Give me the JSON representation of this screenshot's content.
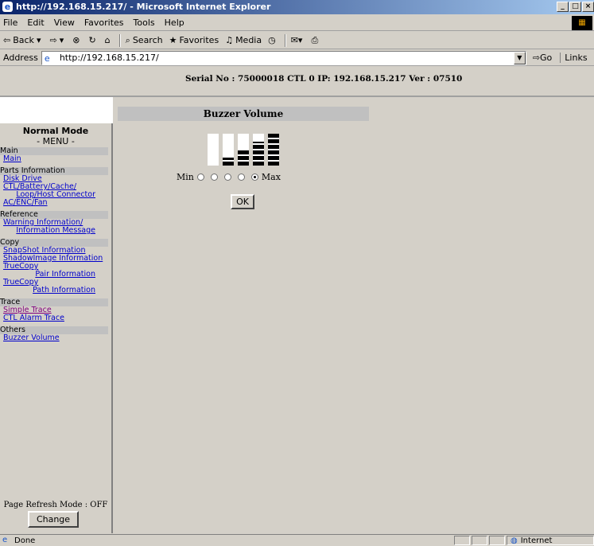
{
  "window": {
    "title": "http://192.168.15.217/ - Microsoft Internet Explorer"
  },
  "menubar": [
    "File",
    "Edit",
    "View",
    "Favorites",
    "Tools",
    "Help"
  ],
  "toolbar": {
    "back": "Back",
    "search": "Search",
    "favorites": "Favorites",
    "media": "Media"
  },
  "address": {
    "label": "Address",
    "url": "http://192.168.15.217/",
    "go": "Go",
    "links": "Links"
  },
  "header": {
    "info": "Serial No : 75000018   CTL 0   IP: 192.168.15.217   Ver : 07510"
  },
  "sidebar": {
    "mode": "Normal Mode",
    "menu_title": "- MENU -",
    "sections": [
      {
        "title": "Main",
        "links": [
          {
            "label": "Main"
          }
        ]
      },
      {
        "title": "Parts Information",
        "links": [
          {
            "label": "Disk Drive"
          },
          {
            "label": "CTL/Battery/Cache/"
          },
          {
            "label": "Loop/Host Connector",
            "indent": true
          },
          {
            "label": "AC/ENC/Fan"
          }
        ]
      },
      {
        "title": "Reference",
        "links": [
          {
            "label": "Warning Information/"
          },
          {
            "label": "Information Message",
            "indent": true
          }
        ]
      },
      {
        "title": "Copy",
        "links": [
          {
            "label": "SnapShot Information"
          },
          {
            "label": "ShadowImage Information"
          },
          {
            "label": "TrueCopy"
          },
          {
            "label": "Pair Information",
            "indent": true
          },
          {
            "label": "TrueCopy"
          },
          {
            "label": "Path Information",
            "indent": true
          }
        ]
      },
      {
        "title": "Trace",
        "links": [
          {
            "label": "Simple Trace",
            "visited": true
          },
          {
            "label": "CTL Alarm Trace"
          }
        ]
      },
      {
        "title": "Others",
        "links": [
          {
            "label": "Buzzer Volume"
          }
        ]
      }
    ],
    "refresh_mode": "Page Refresh Mode : OFF",
    "change_button": "Change"
  },
  "main": {
    "title": "Buzzer Volume",
    "min_label": "Min",
    "max_label": "Max",
    "volume_levels": 5,
    "selected_level": 5,
    "ok_button": "OK"
  },
  "status": {
    "text": "Done",
    "zone": "Internet"
  }
}
